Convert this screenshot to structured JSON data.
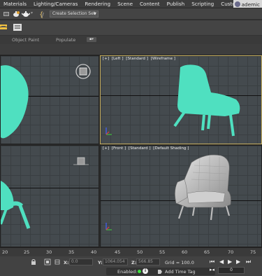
{
  "menu": {
    "items": [
      "Materials",
      "Lighting/Cameras",
      "Rendering",
      "Scene",
      "Content",
      "Publish",
      "Scripting",
      "Customize"
    ],
    "user": "ademic"
  },
  "toolbar": {
    "selection_set_placeholder": "Create Selection Set"
  },
  "ribbon": {
    "tabs": [
      "Object Paint",
      "Populate"
    ]
  },
  "viewports": {
    "left": {
      "labels": [
        "[+]",
        "[Left ]",
        "[Standard ]",
        "[Wireframe ]"
      ]
    },
    "front": {
      "labels": [
        "[+]",
        "[Front ]",
        "[Standard ]",
        "[Default Shading ]"
      ]
    }
  },
  "timeline": {
    "ticks": [
      "20",
      "25",
      "30",
      "35",
      "40",
      "45",
      "50",
      "55",
      "60",
      "65",
      "70",
      "75"
    ]
  },
  "status": {
    "x_label": "X:",
    "x_value": "0.0",
    "y_label": "Y:",
    "y_value": "1064.054",
    "z_label": "Z:",
    "z_value": "566.85",
    "grid": "Grid = 100.0",
    "enabled": "Enabled:",
    "add_time_tag": "Add Time Tag",
    "frame": "0"
  },
  "colors": {
    "chair_teal": "#4fe0c0",
    "active_border": "#c8b060",
    "viewport_bg": "#444a4e"
  }
}
